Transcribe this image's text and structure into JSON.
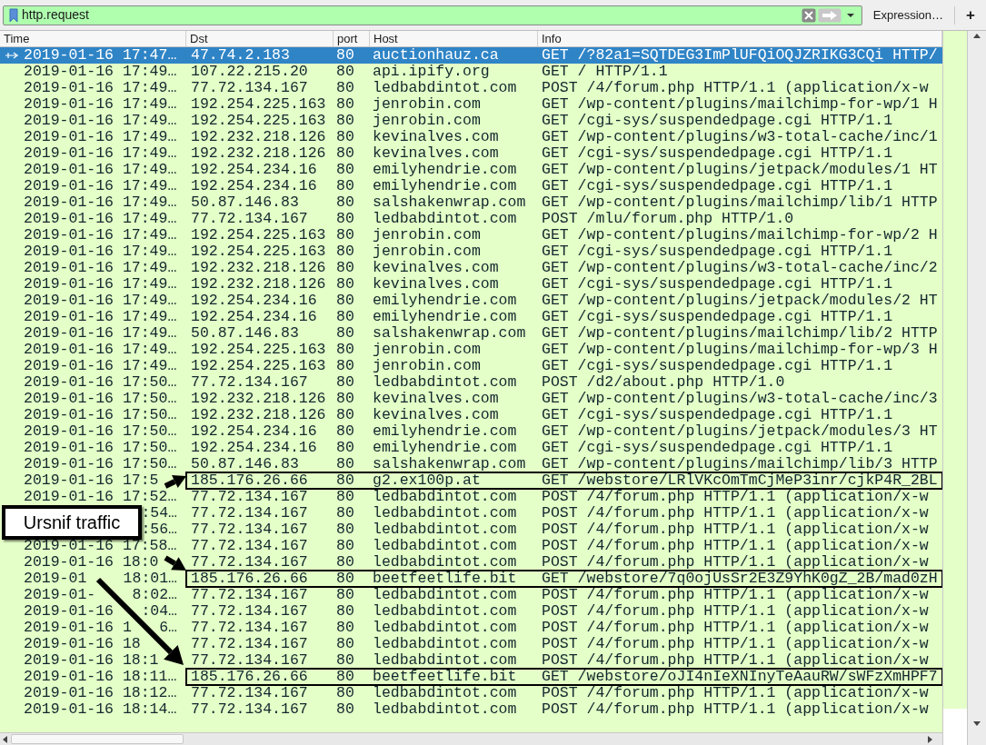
{
  "filter": {
    "value": "http.request",
    "expression_label": "Expression…",
    "add_label": "+"
  },
  "columns": [
    "Time",
    "Dst",
    "port",
    "Host",
    "Info"
  ],
  "rows": [
    {
      "time": "2019-01-16 17:47…",
      "dst": "47.74.2.183",
      "port": "80",
      "host": "auctionhauz.ca",
      "info": "GET /?82a1=SQTDEG3ImPlUFQiOQJZRIKG3CQi HTTP/",
      "selected": true,
      "boxed": false
    },
    {
      "time": "2019-01-16 17:49…",
      "dst": "107.22.215.20",
      "port": "80",
      "host": "api.ipify.org",
      "info": "GET / HTTP/1.1",
      "selected": false,
      "boxed": false
    },
    {
      "time": "2019-01-16 17:49…",
      "dst": "77.72.134.167",
      "port": "80",
      "host": "ledbabdintot.com",
      "info": "POST /4/forum.php HTTP/1.1  (application/x-w",
      "selected": false,
      "boxed": false
    },
    {
      "time": "2019-01-16 17:49…",
      "dst": "192.254.225.163",
      "port": "80",
      "host": "jenrobin.com",
      "info": "GET /wp-content/plugins/mailchimp-for-wp/1 H",
      "selected": false,
      "boxed": false
    },
    {
      "time": "2019-01-16 17:49…",
      "dst": "192.254.225.163",
      "port": "80",
      "host": "jenrobin.com",
      "info": "GET /cgi-sys/suspendedpage.cgi HTTP/1.1",
      "selected": false,
      "boxed": false
    },
    {
      "time": "2019-01-16 17:49…",
      "dst": "192.232.218.126",
      "port": "80",
      "host": "kevinalves.com",
      "info": "GET /wp-content/plugins/w3-total-cache/inc/1",
      "selected": false,
      "boxed": false
    },
    {
      "time": "2019-01-16 17:49…",
      "dst": "192.232.218.126",
      "port": "80",
      "host": "kevinalves.com",
      "info": "GET /cgi-sys/suspendedpage.cgi HTTP/1.1",
      "selected": false,
      "boxed": false
    },
    {
      "time": "2019-01-16 17:49…",
      "dst": "192.254.234.16",
      "port": "80",
      "host": "emilyhendrie.com",
      "info": "GET /wp-content/plugins/jetpack/modules/1 HT",
      "selected": false,
      "boxed": false
    },
    {
      "time": "2019-01-16 17:49…",
      "dst": "192.254.234.16",
      "port": "80",
      "host": "emilyhendrie.com",
      "info": "GET /cgi-sys/suspendedpage.cgi HTTP/1.1",
      "selected": false,
      "boxed": false
    },
    {
      "time": "2019-01-16 17:49…",
      "dst": "50.87.146.83",
      "port": "80",
      "host": "salshakenwrap.com",
      "info": "GET /wp-content/plugins/mailchimp/lib/1 HTTP",
      "selected": false,
      "boxed": false
    },
    {
      "time": "2019-01-16 17:49…",
      "dst": "77.72.134.167",
      "port": "80",
      "host": "ledbabdintot.com",
      "info": "POST /mlu/forum.php HTTP/1.0",
      "selected": false,
      "boxed": false
    },
    {
      "time": "2019-01-16 17:49…",
      "dst": "192.254.225.163",
      "port": "80",
      "host": "jenrobin.com",
      "info": "GET /wp-content/plugins/mailchimp-for-wp/2 H",
      "selected": false,
      "boxed": false
    },
    {
      "time": "2019-01-16 17:49…",
      "dst": "192.254.225.163",
      "port": "80",
      "host": "jenrobin.com",
      "info": "GET /cgi-sys/suspendedpage.cgi HTTP/1.1",
      "selected": false,
      "boxed": false
    },
    {
      "time": "2019-01-16 17:49…",
      "dst": "192.232.218.126",
      "port": "80",
      "host": "kevinalves.com",
      "info": "GET /wp-content/plugins/w3-total-cache/inc/2",
      "selected": false,
      "boxed": false
    },
    {
      "time": "2019-01-16 17:49…",
      "dst": "192.232.218.126",
      "port": "80",
      "host": "kevinalves.com",
      "info": "GET /cgi-sys/suspendedpage.cgi HTTP/1.1",
      "selected": false,
      "boxed": false
    },
    {
      "time": "2019-01-16 17:49…",
      "dst": "192.254.234.16",
      "port": "80",
      "host": "emilyhendrie.com",
      "info": "GET /wp-content/plugins/jetpack/modules/2 HT",
      "selected": false,
      "boxed": false
    },
    {
      "time": "2019-01-16 17:49…",
      "dst": "192.254.234.16",
      "port": "80",
      "host": "emilyhendrie.com",
      "info": "GET /cgi-sys/suspendedpage.cgi HTTP/1.1",
      "selected": false,
      "boxed": false
    },
    {
      "time": "2019-01-16 17:49…",
      "dst": "50.87.146.83",
      "port": "80",
      "host": "salshakenwrap.com",
      "info": "GET /wp-content/plugins/mailchimp/lib/2 HTTP",
      "selected": false,
      "boxed": false
    },
    {
      "time": "2019-01-16 17:49…",
      "dst": "192.254.225.163",
      "port": "80",
      "host": "jenrobin.com",
      "info": "GET /wp-content/plugins/mailchimp-for-wp/3 H",
      "selected": false,
      "boxed": false
    },
    {
      "time": "2019-01-16 17:49…",
      "dst": "192.254.225.163",
      "port": "80",
      "host": "jenrobin.com",
      "info": "GET /cgi-sys/suspendedpage.cgi HTTP/1.1",
      "selected": false,
      "boxed": false
    },
    {
      "time": "2019-01-16 17:50…",
      "dst": "77.72.134.167",
      "port": "80",
      "host": "ledbabdintot.com",
      "info": "POST /d2/about.php HTTP/1.0",
      "selected": false,
      "boxed": false
    },
    {
      "time": "2019-01-16 17:50…",
      "dst": "192.232.218.126",
      "port": "80",
      "host": "kevinalves.com",
      "info": "GET /wp-content/plugins/w3-total-cache/inc/3",
      "selected": false,
      "boxed": false
    },
    {
      "time": "2019-01-16 17:50…",
      "dst": "192.232.218.126",
      "port": "80",
      "host": "kevinalves.com",
      "info": "GET /cgi-sys/suspendedpage.cgi HTTP/1.1",
      "selected": false,
      "boxed": false
    },
    {
      "time": "2019-01-16 17:50…",
      "dst": "192.254.234.16",
      "port": "80",
      "host": "emilyhendrie.com",
      "info": "GET /wp-content/plugins/jetpack/modules/3 HT",
      "selected": false,
      "boxed": false
    },
    {
      "time": "2019-01-16 17:50…",
      "dst": "192.254.234.16",
      "port": "80",
      "host": "emilyhendrie.com",
      "info": "GET /cgi-sys/suspendedpage.cgi HTTP/1.1",
      "selected": false,
      "boxed": false
    },
    {
      "time": "2019-01-16 17:50…",
      "dst": "50.87.146.83",
      "port": "80",
      "host": "salshakenwrap.com",
      "info": "GET /wp-content/plugins/mailchimp/lib/3 HTTP",
      "selected": false,
      "boxed": false
    },
    {
      "time": "2019-01-16 17:5",
      "dst": "185.176.26.66",
      "port": "80",
      "host": "g2.ex100p.at",
      "info": "GET /webstore/LRlVKcOmTmCjMeP3inr/cjkP4R_2BL",
      "selected": false,
      "boxed": true
    },
    {
      "time": "2019-01-16 17:52…",
      "dst": "77.72.134.167",
      "port": "80",
      "host": "ledbabdintot.com",
      "info": "POST /4/forum.php HTTP/1.1  (application/x-w",
      "selected": false,
      "boxed": false
    },
    {
      "time_end": ":54…",
      "dst": "77.72.134.167",
      "port": "80",
      "host": "ledbabdintot.com",
      "info": "POST /4/forum.php HTTP/1.1  (application/x-w",
      "selected": false,
      "boxed": false
    },
    {
      "time_end": ":56…",
      "dst": "77.72.134.167",
      "port": "80",
      "host": "ledbabdintot.com",
      "info": "POST /4/forum.php HTTP/1.1  (application/x-w",
      "selected": false,
      "boxed": false
    },
    {
      "time": "2019-01-16 17:58…",
      "dst": "77.72.134.167",
      "port": "80",
      "host": "ledbabdintot.com",
      "info": "POST /4/forum.php HTTP/1.1  (application/x-w",
      "selected": false,
      "boxed": false
    },
    {
      "time": "2019-01-16 18:0",
      "dst": "77.72.134.167",
      "port": "80",
      "host": "ledbabdintot.com",
      "info": "POST /4/forum.php HTTP/1.1  (application/x-w",
      "selected": false,
      "boxed": false
    },
    {
      "time": "2019-01",
      "time_end": "18:01…",
      "dst": "185.176.26.66",
      "port": "80",
      "host": "beetfeetlife.bit",
      "info": "GET /webstore/7q0ojUsSr2E3Z9YhK0gZ_2B/mad0zH",
      "selected": false,
      "boxed": true
    },
    {
      "time": "2019-01-",
      "time_end": "8:02…",
      "dst": "77.72.134.167",
      "port": "80",
      "host": "ledbabdintot.com",
      "info": "POST /4/forum.php HTTP/1.1  (application/x-w",
      "selected": false,
      "boxed": false
    },
    {
      "time": "2019-01-16",
      "time_end": ":04…",
      "dst": "77.72.134.167",
      "port": "80",
      "host": "ledbabdintot.com",
      "info": "POST /4/forum.php HTTP/1.1  (application/x-w",
      "selected": false,
      "boxed": false
    },
    {
      "time": "2019-01-16 1",
      "time_end": "6…",
      "dst": "77.72.134.167",
      "port": "80",
      "host": "ledbabdintot.com",
      "info": "POST /4/forum.php HTTP/1.1  (application/x-w",
      "selected": false,
      "boxed": false
    },
    {
      "time": "2019-01-16 18",
      "dst": "77.72.134.167",
      "port": "80",
      "host": "ledbabdintot.com",
      "info": "POST /4/forum.php HTTP/1.1  (application/x-w",
      "selected": false,
      "boxed": false
    },
    {
      "time": "2019-01-16 18:1",
      "dst": "77.72.134.167",
      "port": "80",
      "host": "ledbabdintot.com",
      "info": "POST /4/forum.php HTTP/1.1  (application/x-w",
      "selected": false,
      "boxed": false
    },
    {
      "time": "2019-01-16 18:11…",
      "dst": "185.176.26.66",
      "port": "80",
      "host": "beetfeetlife.bit",
      "info": "GET /webstore/oJI4nIeXNInyTeAauRW/sWFzXmHPF7",
      "selected": false,
      "boxed": true
    },
    {
      "time": "2019-01-16 18:12…",
      "dst": "77.72.134.167",
      "port": "80",
      "host": "ledbabdintot.com",
      "info": "POST /4/forum.php HTTP/1.1  (application/x-w",
      "selected": false,
      "boxed": false
    },
    {
      "time": "2019-01-16 18:14…",
      "dst": "77.72.134.167",
      "port": "80",
      "host": "ledbabdintot.com",
      "info": "POST /4/forum.php HTTP/1.1  (application/x-w",
      "selected": false,
      "boxed": false
    }
  ],
  "callout": {
    "text": "Ursnif traffic"
  }
}
